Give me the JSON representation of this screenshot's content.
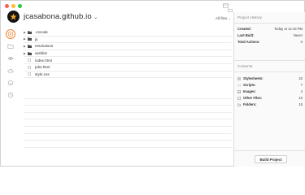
{
  "header": {
    "project_title": "jcasabona.github.io",
    "title_chevron": "⌄",
    "filter_label": "All files",
    "filter_chevron": "⌄"
  },
  "sidebar": {
    "items": [
      {
        "name": "compass",
        "active": true
      },
      {
        "name": "folder"
      },
      {
        "name": "eye"
      },
      {
        "name": "cloud"
      },
      {
        "name": "upload"
      },
      {
        "name": "clock"
      }
    ]
  },
  "files": [
    {
      "name": ".vscode",
      "type": "folder",
      "expandable": true
    },
    {
      "name": "js",
      "type": "folder",
      "expandable": true
    },
    {
      "name": "resolutions",
      "type": "folder",
      "expandable": true
    },
    {
      "name": "wishlist",
      "type": "folder",
      "expandable": true
    },
    {
      "name": "index.html",
      "type": "file",
      "expandable": false
    },
    {
      "name": "jobs.html",
      "type": "file",
      "expandable": false
    },
    {
      "name": "style.css",
      "type": "file",
      "expandable": false
    }
  ],
  "history": {
    "title": "Project History",
    "rows": [
      {
        "label": "Created:",
        "value": "Today at 12:18 PM"
      },
      {
        "label": "Last Built:",
        "value": "Never"
      },
      {
        "label": "Total Actions:",
        "value": "0"
      }
    ]
  },
  "contents": {
    "title": "Contents",
    "rows": [
      {
        "label": "Stylesheets:",
        "value": "22",
        "icon": "stylesheet-icon"
      },
      {
        "label": "Scripts:",
        "value": "7",
        "icon": "script-icon"
      },
      {
        "label": "Images:",
        "value": "4",
        "icon": "image-icon"
      },
      {
        "label": "Other Files:",
        "value": "10",
        "icon": "document-icon"
      },
      {
        "label": "Folders:",
        "value": "15",
        "icon": "folder-icon"
      }
    ]
  },
  "build_button": "Build Project",
  "colors": {
    "accent": "#f0822f",
    "folder": "#4a4a4a"
  }
}
